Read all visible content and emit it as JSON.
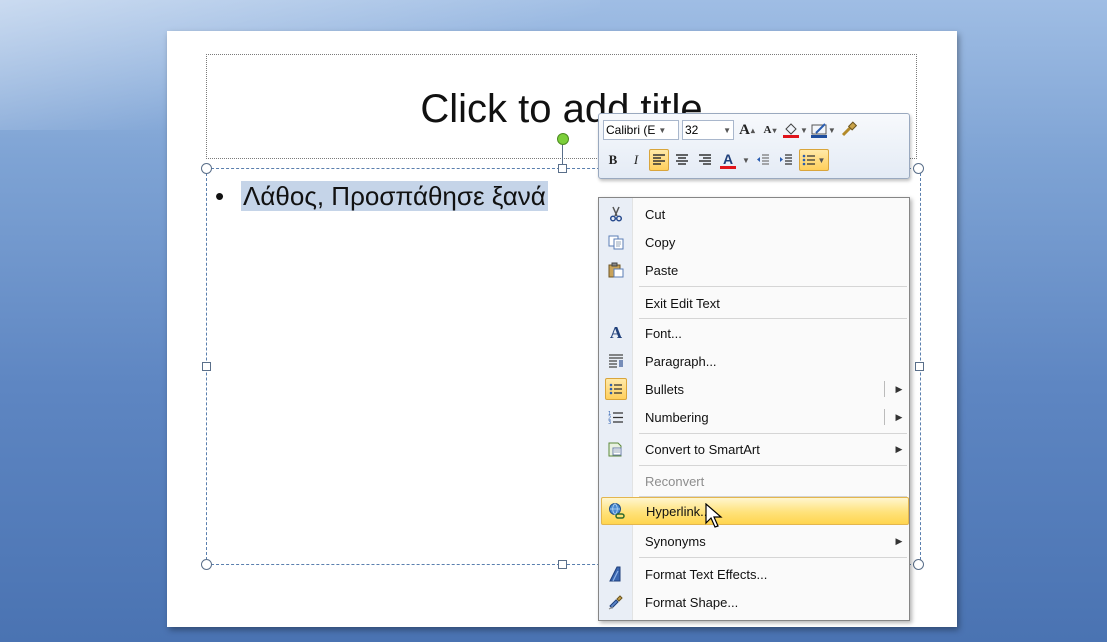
{
  "slide": {
    "title_placeholder": "Click to add title",
    "bullet": "•",
    "body_text": "Λάθος, Προσπάθησε ξανά"
  },
  "mini_toolbar": {
    "font_name": "Calibri (E",
    "font_size": "32",
    "grow_font": "A",
    "shrink_font": "A",
    "bold": "B",
    "italic": "I",
    "font_color": "A"
  },
  "context_menu": {
    "items": [
      {
        "label": "Cut",
        "icon": "scissors-icon"
      },
      {
        "label": "Copy",
        "icon": "copy-icon"
      },
      {
        "label": "Paste",
        "icon": "paste-icon"
      },
      {
        "label": "Exit Edit Text",
        "icon": ""
      },
      {
        "label": "Font...",
        "icon": "font-icon"
      },
      {
        "label": "Paragraph...",
        "icon": "paragraph-icon"
      },
      {
        "label": "Bullets",
        "icon": "bullets-icon",
        "submenu": true
      },
      {
        "label": "Numbering",
        "icon": "numbering-icon",
        "submenu": true
      },
      {
        "label": "Convert to SmartArt",
        "icon": "smartart-icon",
        "submenu": true
      },
      {
        "label": "Reconvert",
        "icon": "",
        "disabled": true
      },
      {
        "label": "Hyperlink...",
        "icon": "hyperlink-icon",
        "highlighted": true
      },
      {
        "label": "Synonyms",
        "icon": "",
        "submenu": true
      },
      {
        "label": "Format Text Effects...",
        "icon": "text-effects-icon"
      },
      {
        "label": "Format Shape...",
        "icon": "format-shape-icon"
      }
    ]
  },
  "colors": {
    "accent_highlight": "#ffd54f",
    "selection": "#c5d4e8",
    "font_color_bar": "#e0141b",
    "highlight_bar": "#e0141b"
  }
}
